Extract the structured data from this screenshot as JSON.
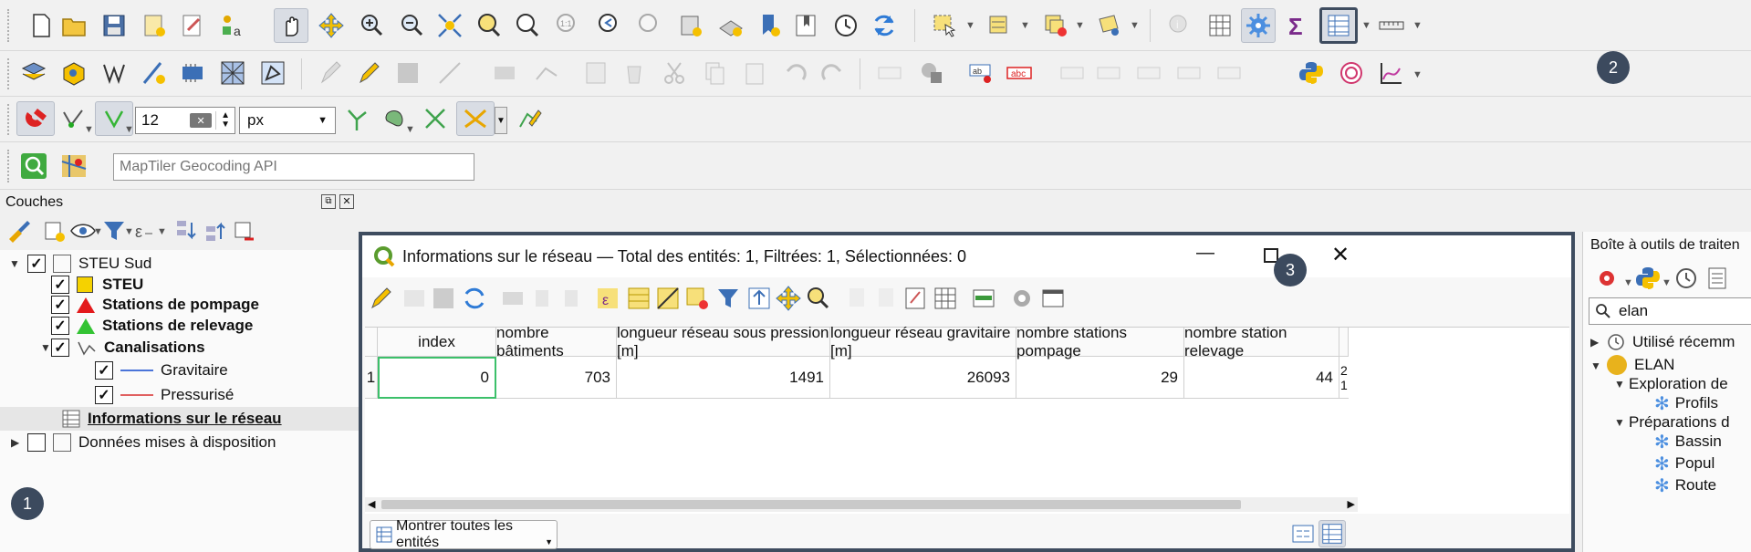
{
  "toolbar_digit": {
    "size_value": "12",
    "unit_value": "px"
  },
  "geocoder": {
    "placeholder": "MapTiler Geocoding API"
  },
  "layers_panel": {
    "title": "Couches",
    "tree": [
      {
        "label": "STEU Sud",
        "bold": false
      },
      {
        "label": "STEU",
        "bold": true
      },
      {
        "label": "Stations de pompage",
        "bold": true
      },
      {
        "label": "Stations de relevage",
        "bold": true
      },
      {
        "label": "Canalisations",
        "bold": true
      },
      {
        "label": "Gravitaire",
        "bold": false
      },
      {
        "label": "Pressurisé",
        "bold": false
      },
      {
        "label": "Informations sur le réseau",
        "bold": true
      },
      {
        "label": "Données mises à disposition",
        "bold": false
      }
    ],
    "colors": {
      "steu": "#f5d200",
      "pompage": "#e31a1c",
      "relevage": "#33c333",
      "gravitaire": "#4a74d9",
      "pressurise": "#e06060"
    }
  },
  "badges": {
    "b1": "1",
    "b2": "2",
    "b3": "3"
  },
  "attr_table": {
    "title": "Informations sur le réseau — Total des entités: 1, Filtrées: 1, Sélectionnées: 0",
    "headers": [
      "index",
      "nombre bâtiments",
      "longueur réseau sous pression [m]",
      "longueur réseau gravitaire [m]",
      "nombre stations pompage",
      "nombre station relevage"
    ],
    "row_number": "1",
    "row": [
      "0",
      "703",
      "1491",
      "26093",
      "29",
      "44"
    ],
    "clipped_col": [
      "2",
      "1"
    ],
    "filter_button": "Montrer toutes les entités"
  },
  "toolbox": {
    "title": "Boîte à outils de traiten",
    "search_value": "elan",
    "items": [
      "Utilisé récemm",
      "ELAN",
      "Exploration de",
      "Profils",
      "Préparations d",
      "Bassin",
      "Popul",
      "Route"
    ]
  }
}
